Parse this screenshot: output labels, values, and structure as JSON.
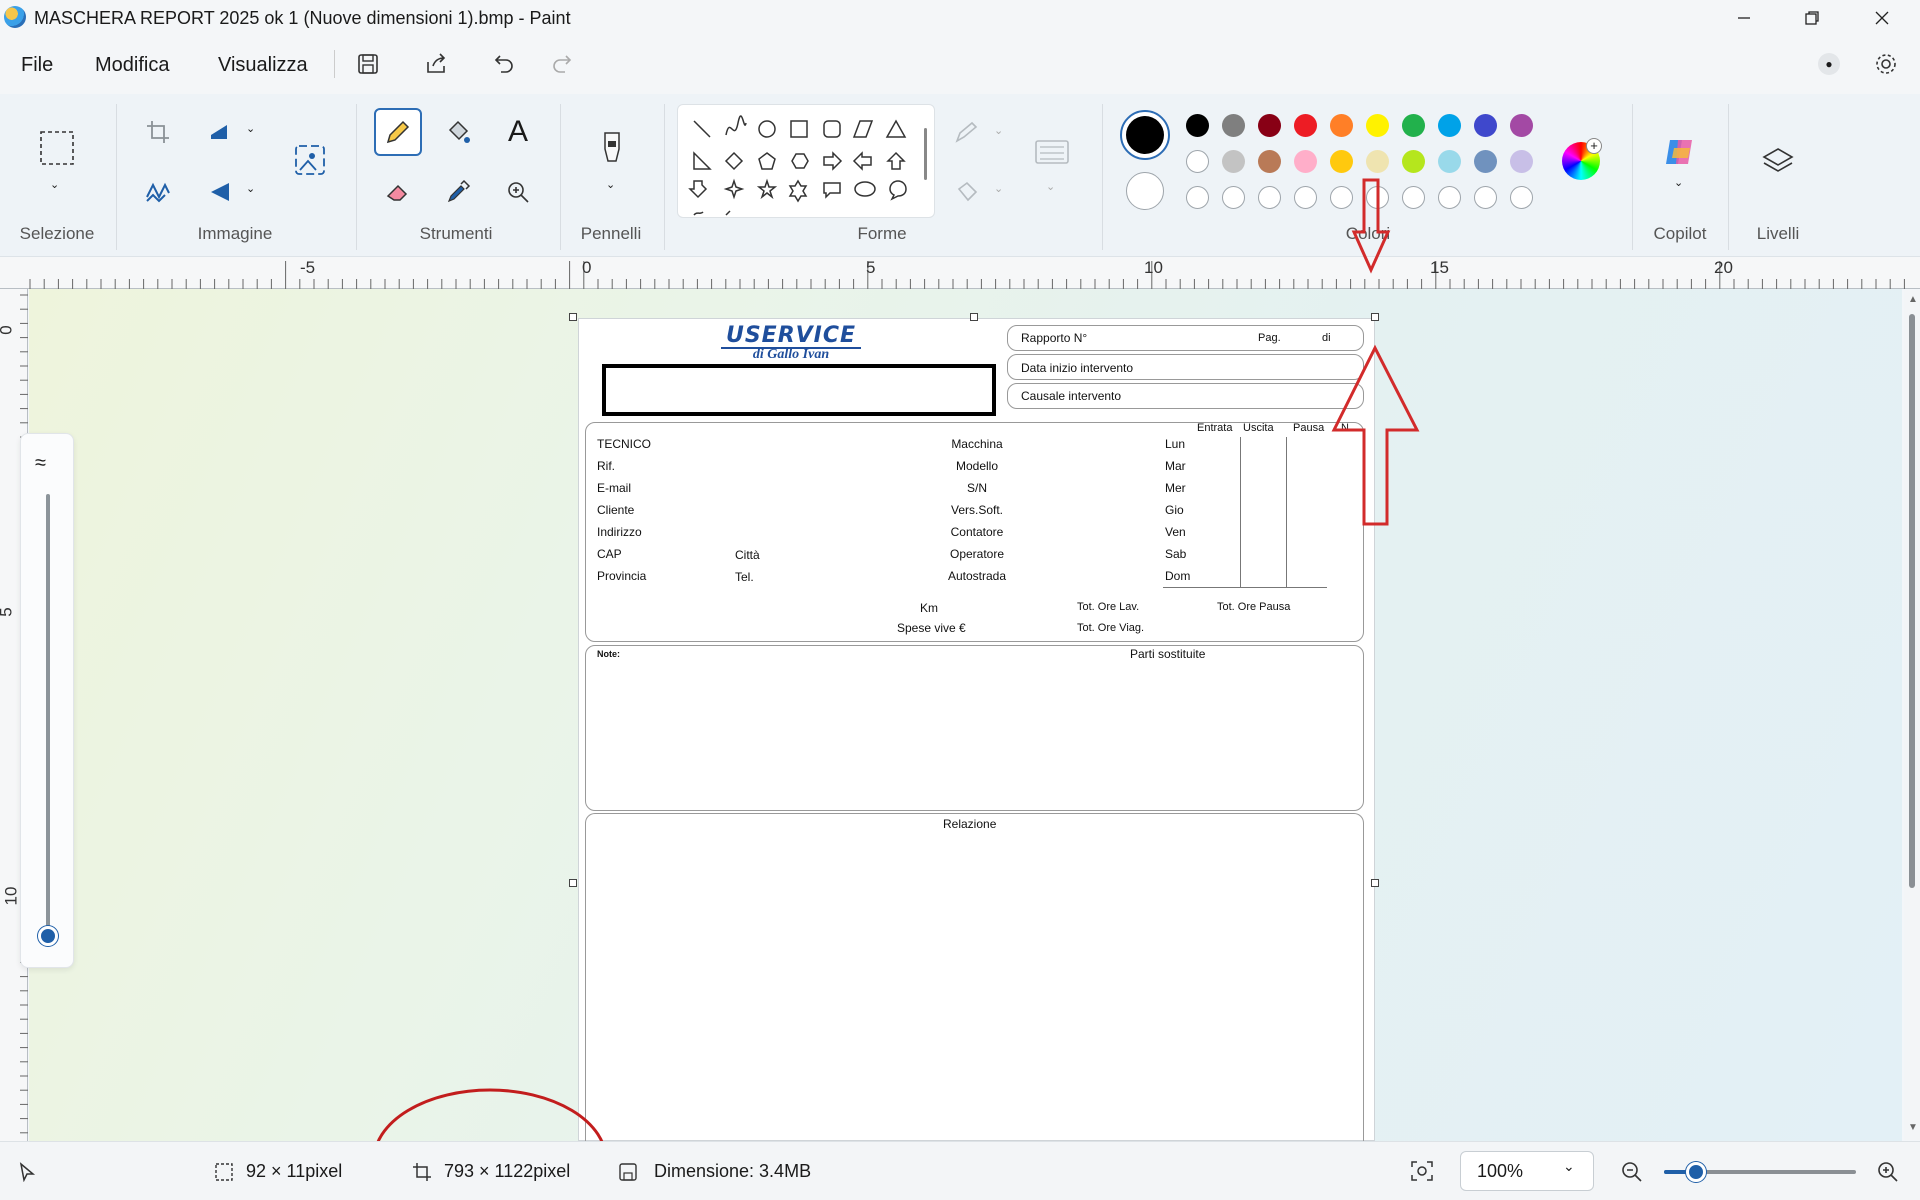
{
  "window": {
    "title": "MASCHERA REPORT 2025 ok 1 (Nuove dimensioni 1).bmp - Paint"
  },
  "menu": {
    "file": "File",
    "edit": "Modifica",
    "view": "Visualizza"
  },
  "ribbon": {
    "groups": {
      "selection": "Selezione",
      "image": "Immagine",
      "tools": "Strumenti",
      "brushes": "Pennelli",
      "shapes": "Forme",
      "colors": "Colori",
      "copilot": "Copilot",
      "layers": "Livelli"
    }
  },
  "palette": {
    "primary": "#000000",
    "secondary": "#ffffff",
    "row1": [
      "#000000",
      "#7f7f7f",
      "#880015",
      "#ed1c24",
      "#ff7f27",
      "#fff200",
      "#22b14c",
      "#00a2e8",
      "#3f48cc",
      "#a349a4"
    ],
    "row2": [
      "#ffffff",
      "#c3c3c3",
      "#b97a57",
      "#ffaec9",
      "#ffc90e",
      "#efe4b0",
      "#b5e61d",
      "#99d9ea",
      "#7092be",
      "#c8bfe7"
    ]
  },
  "ruler": {
    "h": [
      "-5",
      "0",
      "5",
      "10",
      "15",
      "20"
    ],
    "v": [
      "0",
      "5",
      "10"
    ]
  },
  "doc": {
    "logo": "USERVICE",
    "logo_sub": "di Gallo Ivan",
    "rapporto": "Rapporto N°",
    "pag": "Pag.",
    "di": "di",
    "data_inizio": "Data inizio intervento",
    "causale": "Causale intervento",
    "col_entrata": "Entrata",
    "col_uscita": "Uscita",
    "col_pausa": "Pausa",
    "col_n": "N",
    "left_labels": [
      "TECNICO",
      "Rif.",
      "E-mail",
      "Cliente",
      "Indirizzo",
      "CAP",
      "Provincia"
    ],
    "citta": "Città",
    "tel": "Tel.",
    "mid_labels": [
      "Macchina",
      "Modello",
      "S/N",
      "Vers.Soft.",
      "Contatore",
      "Operatore",
      "Autostrada"
    ],
    "days": [
      "Lun",
      "Mar",
      "Mer",
      "Gio",
      "Ven",
      "Sab",
      "Dom"
    ],
    "km": "Km",
    "spese": "Spese vive €",
    "tot_ore_lav": "Tot. Ore Lav.",
    "tot_ore_viag": "Tot. Ore Viag.",
    "tot_ore_pausa": "Tot. Ore Pausa",
    "note": "Note:",
    "parti": "Parti sostituite",
    "relazione": "Relazione"
  },
  "status": {
    "selection_size": "92 × 11pixel",
    "canvas_size": "793 × 1122pixel",
    "file_size": "Dimensione: 3.4MB",
    "zoom": "100%"
  }
}
